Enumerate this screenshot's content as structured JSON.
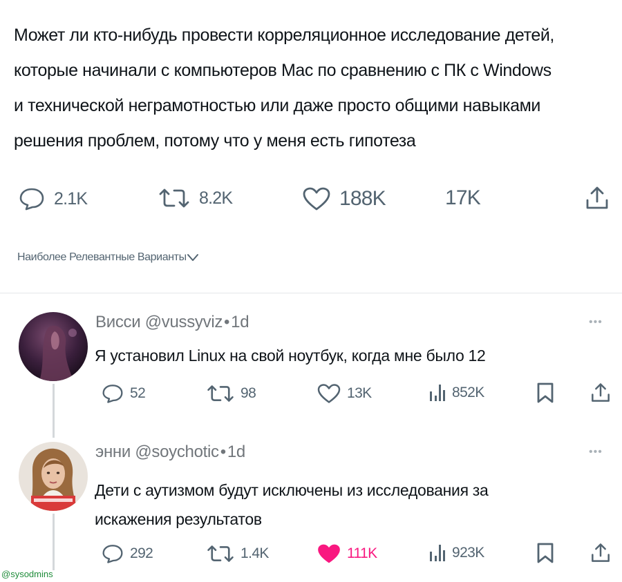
{
  "post": {
    "text_lines": [
      "Может ли кто-нибудь провести корреляционное исследование детей,",
      "которые начинали с компьютеров Mac по сравнению с ПК с Windows",
      "и технической неграмотностью или даже просто общими навыками",
      "решения проблем, потому что у меня есть гипотеза"
    ],
    "replies": "2.1K",
    "reposts": "8.2K",
    "likes": "188K",
    "views": "17K"
  },
  "sort_label": "Наиболее Релевантные Варианты",
  "replies": [
    {
      "name": "Висси",
      "handle": "@vussyviz",
      "sep": "•",
      "time": "1d",
      "more": "•••",
      "text_lines": [
        "Я установил Linux на свой ноутбук, когда мне было 12"
      ],
      "replies": "52",
      "reposts": "98",
      "likes": "13K",
      "views": "852K",
      "liked": false
    },
    {
      "name": "энни",
      "handle": "@soychotic",
      "sep": "•",
      "time": "1d",
      "more": "•••",
      "text_lines": [
        "Дети с аутизмом будут исключены из исследования за",
        "искажения результатов"
      ],
      "replies": "292",
      "reposts": "1.4K",
      "likes": "111K",
      "views": "923K",
      "liked": true
    }
  ],
  "watermark": "@sysodmins",
  "colors": {
    "icon_gray": "#536471",
    "like_pink": "#f91880",
    "divider": "#e4e7ea"
  }
}
